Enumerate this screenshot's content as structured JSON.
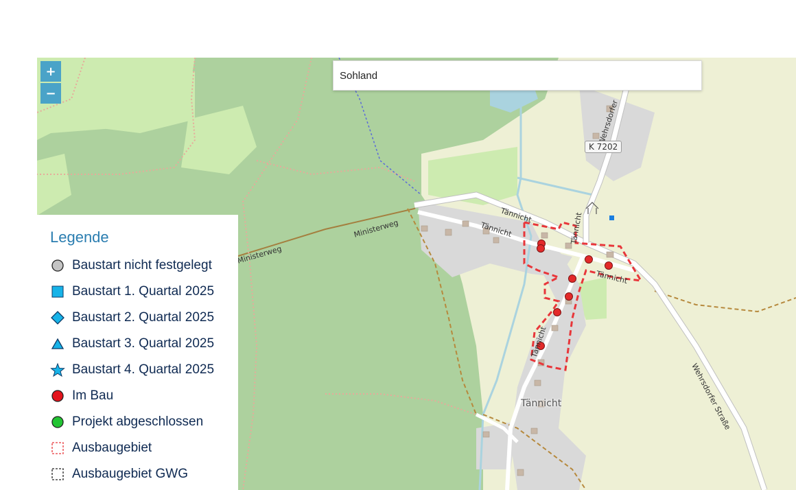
{
  "map": {
    "search_value": "Sohland",
    "zoom_in_label": "+",
    "zoom_out_label": "−",
    "labels": {
      "ministerweg_1": "Ministerweg",
      "ministerweg_2": "Ministerweg",
      "taennicht_1": "Tännicht",
      "taennicht_2": "Tännicht",
      "taennicht_3": "Tännicht",
      "taennicht_4": "Tännicht",
      "taennicht_5": "Tännicht",
      "wehrsdorfer_1": "Wehrsdorfer",
      "wehrsdorfer_2": "Wehrsdorfer Straße",
      "road_ref": "K 7202",
      "place": "Tännicht"
    },
    "colors": {
      "forest": "#add19e",
      "meadow": "#cdebb0",
      "residential": "#d9d9d9",
      "farmland": "#eef0d5",
      "road": "#ffffff",
      "stream": "#aad3df",
      "area_outline": "#e8363a",
      "marker_red": "#e32a2a"
    },
    "icons": [
      "hut-icon",
      "blue-square-marker"
    ]
  },
  "legend": {
    "title": "Legende",
    "items": [
      {
        "label": "Baustart nicht festgelegt",
        "icon": "grey-circle-icon",
        "color": "#c4c4c4"
      },
      {
        "label": "Baustart 1. Quartal 2025",
        "icon": "blue-square-icon",
        "color": "#17b3e8"
      },
      {
        "label": "Baustart 2. Quartal 2025",
        "icon": "blue-diamond-icon",
        "color": "#17b3e8"
      },
      {
        "label": "Baustart 3. Quartal 2025",
        "icon": "blue-triangle-icon",
        "color": "#17b3e8"
      },
      {
        "label": "Baustart 4. Quartal 2025",
        "icon": "blue-star-icon",
        "color": "#17b3e8"
      },
      {
        "label": "Im Bau",
        "icon": "red-circle-icon",
        "color": "#e3141c"
      },
      {
        "label": "Projekt abgeschlossen",
        "icon": "green-circle-icon",
        "color": "#22c433"
      },
      {
        "label": "Ausbaugebiet",
        "icon": "red-dashed-square-icon",
        "color": "#e8363a"
      },
      {
        "label": "Ausbaugebiet GWG",
        "icon": "black-dashed-square-icon",
        "color": "#222222"
      }
    ]
  }
}
